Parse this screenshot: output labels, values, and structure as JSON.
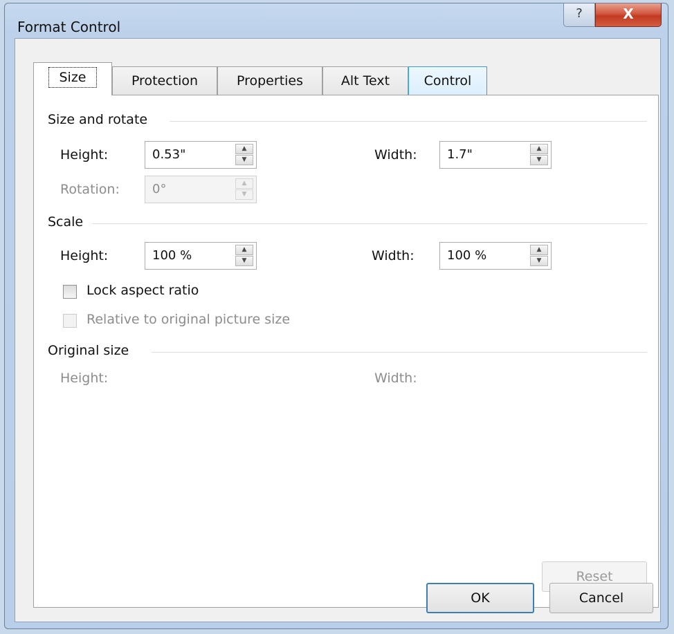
{
  "window": {
    "title": "Format Control",
    "help_glyph": "?",
    "close_glyph": "X"
  },
  "tabs": [
    "Size",
    "Protection",
    "Properties",
    "Alt Text",
    "Control"
  ],
  "size_rotate": {
    "heading": "Size and rotate",
    "height_label": "Height:",
    "height_value": "0.53\"",
    "width_label": "Width:",
    "width_value": "1.7\"",
    "rotation_label": "Rotation:",
    "rotation_value": "0°"
  },
  "scale": {
    "heading": "Scale",
    "height_label": "Height:",
    "height_value": "100 %",
    "width_label": "Width:",
    "width_value": "100 %",
    "lock_aspect": {
      "label": "Lock aspect ratio",
      "checked": false
    },
    "relative_original": {
      "label": "Relative to original picture size",
      "checked": false,
      "enabled": false
    }
  },
  "original_size": {
    "heading": "Original size",
    "height_label": "Height:",
    "width_label": "Width:"
  },
  "buttons": {
    "reset": "Reset",
    "ok": "OK",
    "cancel": "Cancel"
  },
  "icons": {
    "spin_up": "▲",
    "spin_down": "▼"
  }
}
